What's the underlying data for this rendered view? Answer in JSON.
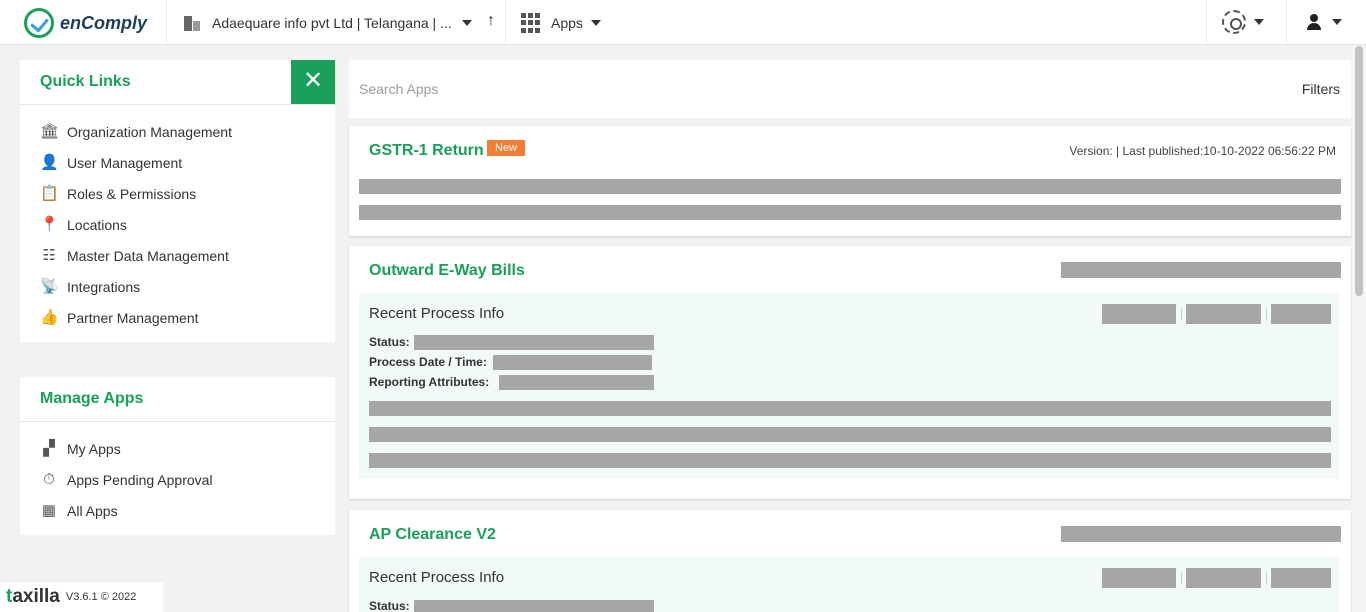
{
  "header": {
    "brand": "enComply",
    "org_name": "Adaequare info pvt Ltd | Telangana | ...",
    "apps_label": "Apps"
  },
  "quick_links": {
    "title": "Quick Links",
    "close_glyph": "✕",
    "items": [
      {
        "label": "Organization Management",
        "icon": "bank-icon"
      },
      {
        "label": "User Management",
        "icon": "user-icon"
      },
      {
        "label": "Roles & Permissions",
        "icon": "clipboard-icon"
      },
      {
        "label": "Locations",
        "icon": "map-pin-icon"
      },
      {
        "label": "Master Data Management",
        "icon": "data-table-icon"
      },
      {
        "label": "Integrations",
        "icon": "antenna-icon"
      },
      {
        "label": "Partner Management",
        "icon": "thumbs-up-icon"
      }
    ]
  },
  "manage_apps": {
    "title": "Manage Apps",
    "items": [
      {
        "label": "My Apps",
        "icon": "apps-plus-icon"
      },
      {
        "label": "Apps Pending Approval",
        "icon": "stopwatch-icon"
      },
      {
        "label": "All Apps",
        "icon": "grid-icon"
      }
    ]
  },
  "footer": {
    "logo_first": "t",
    "logo_rest": "axilla",
    "version": "V3.6.1 © 2022"
  },
  "search": {
    "placeholder": "Search Apps",
    "filters_label": "Filters"
  },
  "cards": [
    {
      "title": "GSTR-1 Return",
      "badge": "New",
      "meta": "Version: | Last published:10-10-2022 06:56:22 PM"
    },
    {
      "title": "Outward E-Way Bills",
      "recent_title": "Recent Process Info",
      "status_label": "Status:",
      "date_label": "Process Date / Time:",
      "attr_label": "Reporting Attributes:"
    },
    {
      "title": "AP Clearance V2",
      "recent_title": "Recent Process Info",
      "status_label": "Status:"
    }
  ],
  "colors": {
    "accent": "#19a05a",
    "badge": "#f47d33",
    "placeholder_bar": "#a6a6a6",
    "recent_bg": "#f1faf4"
  }
}
